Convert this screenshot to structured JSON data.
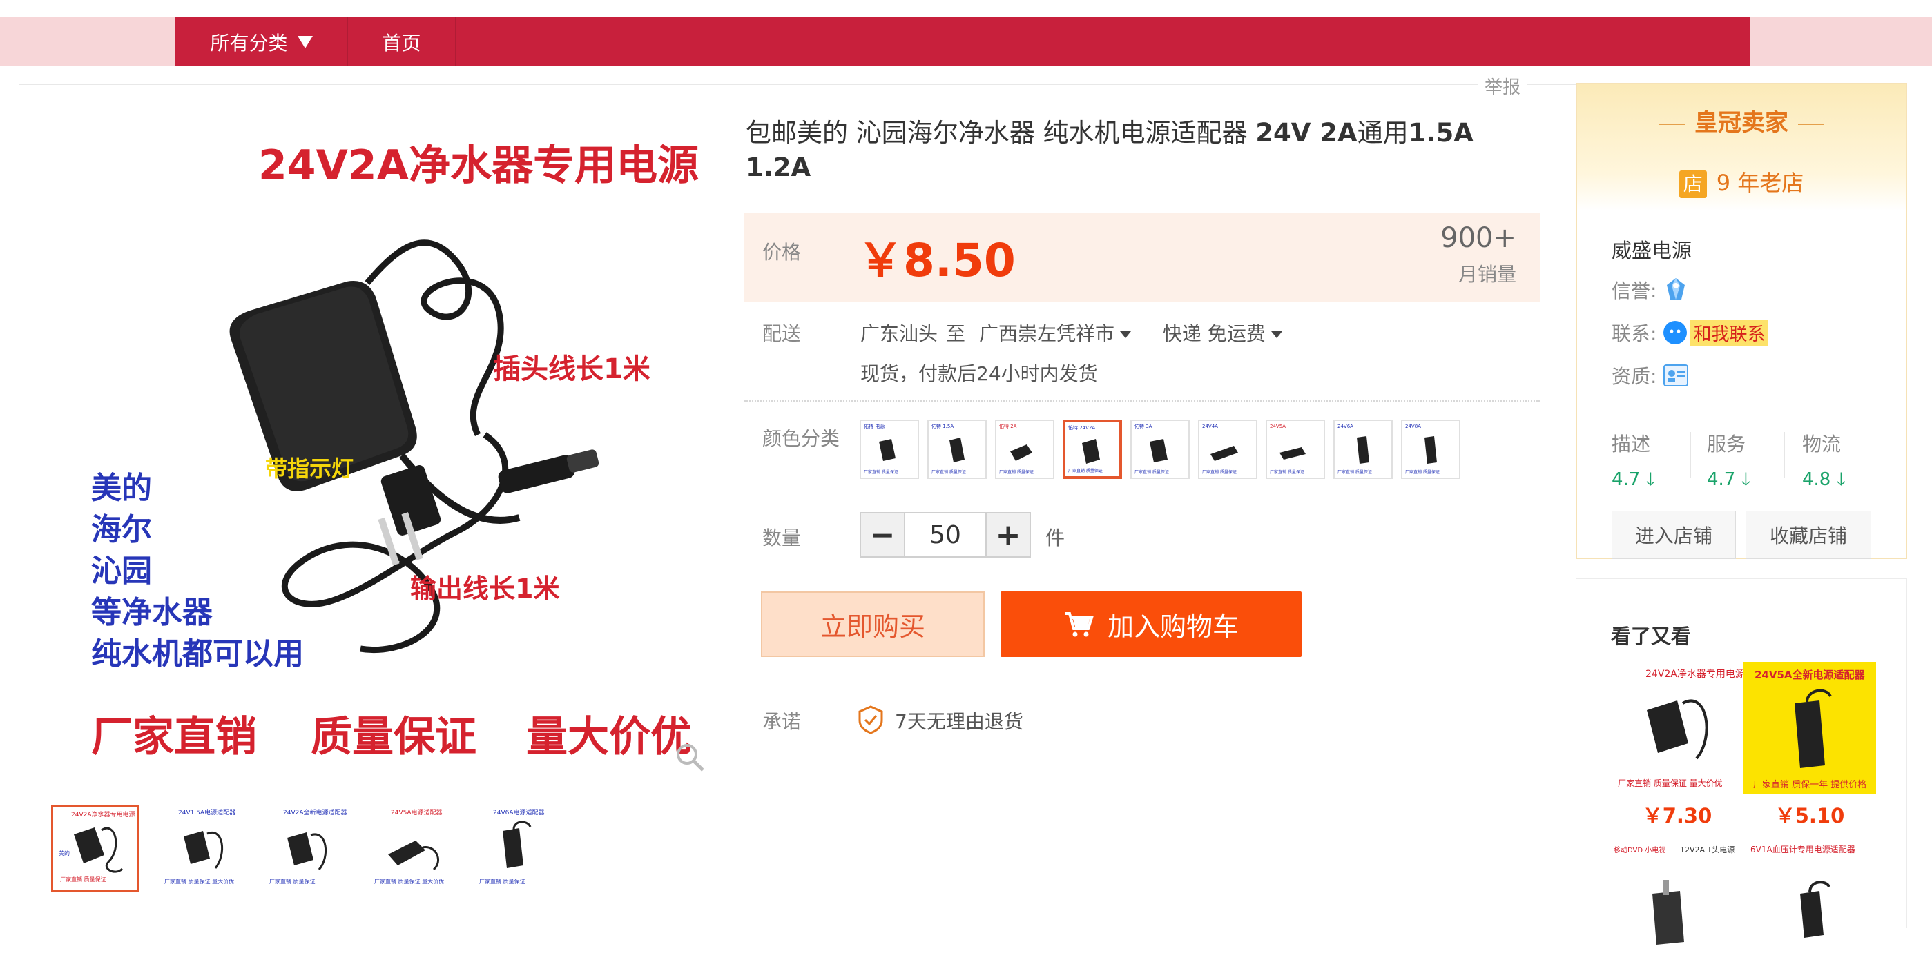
{
  "nav": {
    "all_categories": "所有分类",
    "home": "首页"
  },
  "report": "举报",
  "gallery": {
    "banner_title": "24V2A净水器专用电源",
    "plug_label": "插头线长1米",
    "indicator_label": "带指示灯",
    "output_label": "输出线长1米",
    "compat_lines": [
      "美的",
      "海尔",
      "沁园",
      "等净水器",
      "纯水机都可以用"
    ],
    "slogans": [
      "厂家直销",
      "质量保证",
      "量大价优"
    ],
    "thumb_count": 5
  },
  "product": {
    "title_part1": "包邮美的 沁园海尔净水器 纯水机电源适配器 ",
    "title_bold1": "24V 2A",
    "title_part2": "通用",
    "title_bold2": "1.5A 1.2A",
    "price_label": "价格",
    "price": "￥8.50",
    "monthly_sales": "900+",
    "monthly_sales_label": "月销量",
    "delivery_label": "配送",
    "delivery_from": "广东汕头",
    "delivery_to_word": "至",
    "delivery_to": "广西崇左凭祥市",
    "shipping": "快递 免运费",
    "dispatch_note": "现货，付款后24小时内发货",
    "color_label": "颜色分类",
    "sku_count": 9,
    "sku_selected_index": 3,
    "quantity_label": "数量",
    "quantity": "50",
    "quantity_minus": "−",
    "quantity_plus": "+",
    "quantity_unit": "件",
    "buy_now": "立即购买",
    "add_cart": "加入购物车",
    "promise_label": "承诺",
    "promise_text": "7天无理由退货"
  },
  "seller": {
    "badge_title": "皇冠卖家",
    "store_icon_text": "店",
    "store_age": "9 年老店",
    "name": "威盛电源",
    "reputation_label": "信誉:",
    "contact_label": "联系:",
    "contact_button": "和我联系",
    "qualification_label": "资质:",
    "scores": [
      {
        "label": "描述",
        "value": "4.7"
      },
      {
        "label": "服务",
        "value": "4.7"
      },
      {
        "label": "物流",
        "value": "4.8"
      }
    ],
    "enter_store": "进入店铺",
    "favorite_store": "收藏店铺"
  },
  "reco": {
    "title": "看了又看",
    "items": [
      {
        "price": "￥7.30",
        "img_title": "24V2A净水器专用电源"
      },
      {
        "price": "￥5.10",
        "img_title": "24V5A全新电源适配器"
      },
      {
        "price": "",
        "img_title": "12V2A T头电源"
      },
      {
        "price": "",
        "img_title": "6V1A血压计专用电源适配器"
      }
    ]
  },
  "colors": {
    "brand_red": "#c8203c",
    "price_orange": "#f03c0c",
    "cart_orange": "#fa4e0a",
    "score_green": "#1aa36a"
  }
}
